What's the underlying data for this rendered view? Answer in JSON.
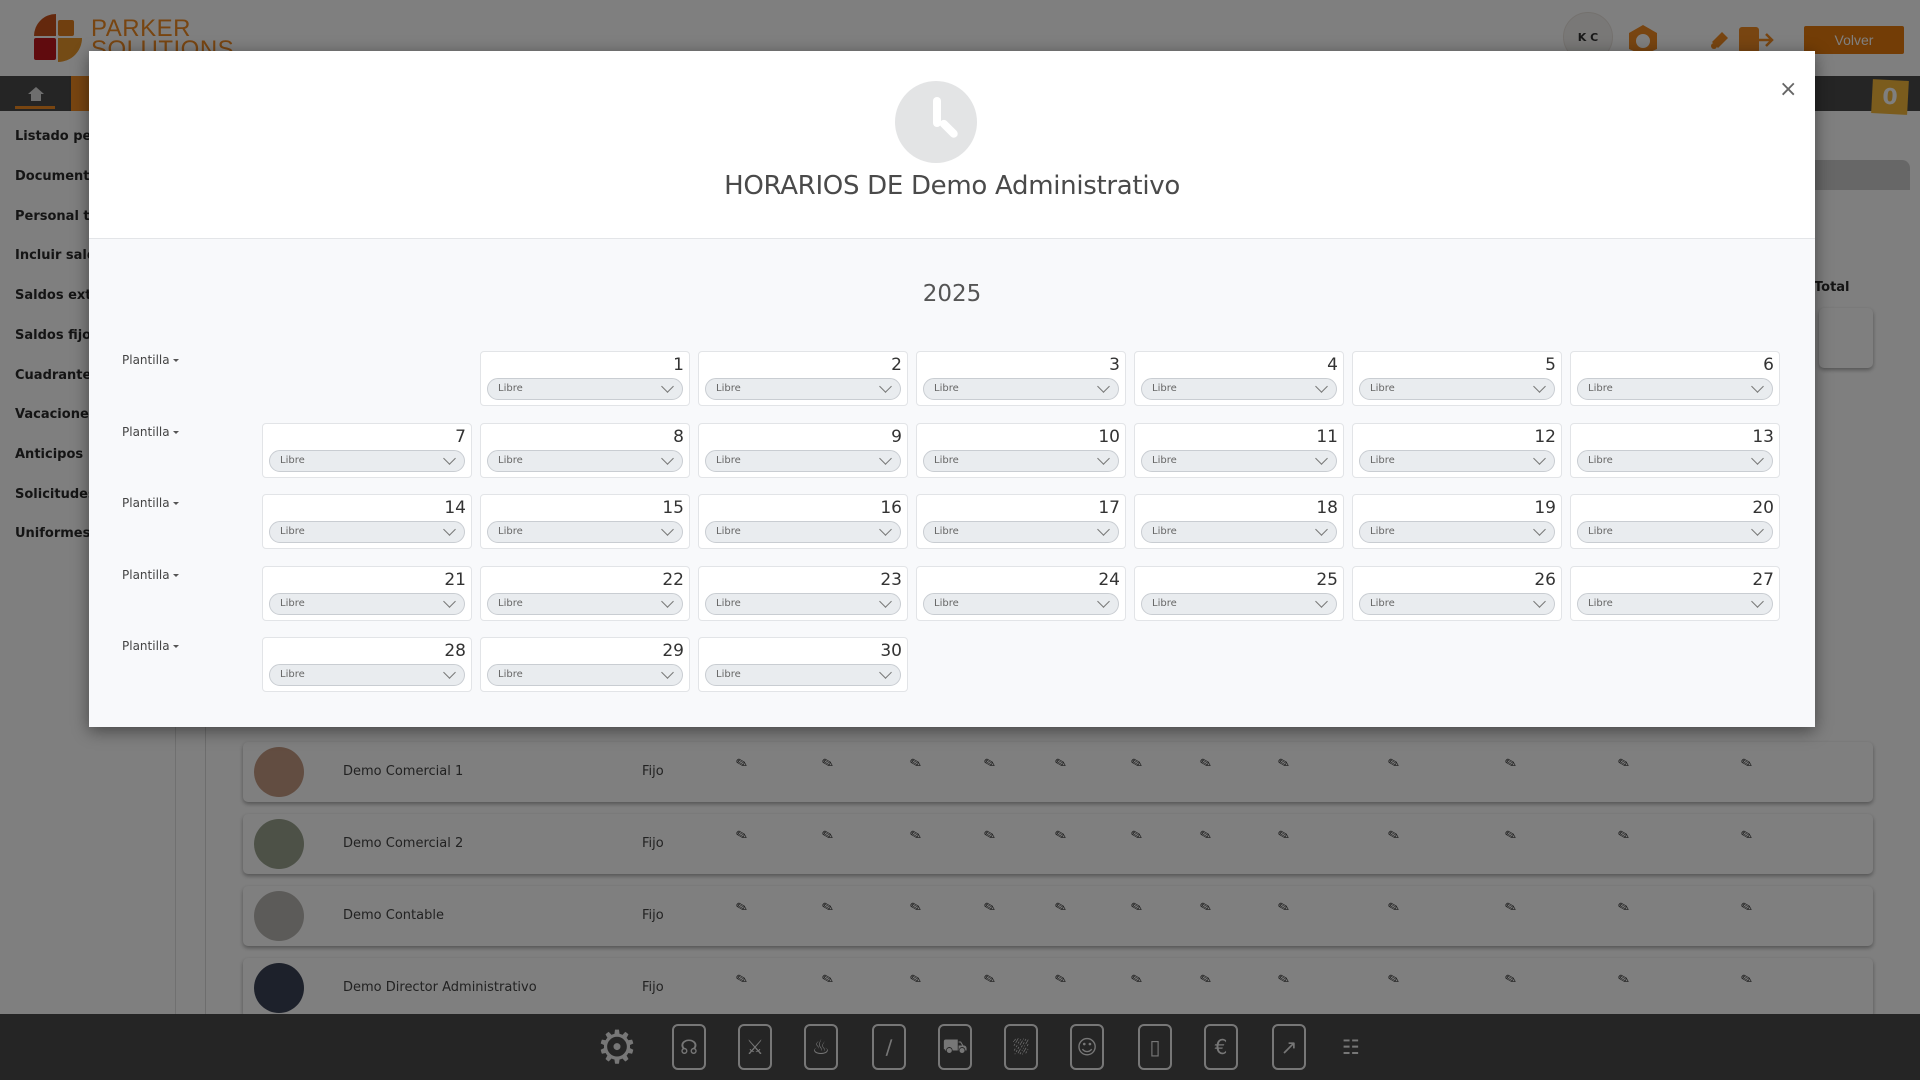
{
  "app": {
    "brand_line1": "PARKER",
    "brand_line2": "SOLUTIONS",
    "company_badge": "K C",
    "volver_label": "Volver",
    "cart_count": "0",
    "sidebar": [
      "Listado personal",
      "Documentos",
      "Personal trabajando",
      "Incluir saldos",
      "Saldos extra",
      "Saldos fijos",
      "Cuadrantes",
      "Vacaciones",
      "Anticipos",
      "Solicitudes",
      "Uniformes"
    ],
    "total_label": "Total",
    "employees": [
      {
        "name": "Demo Comercial 1",
        "type": "Fijo"
      },
      {
        "name": "Demo Comercial 2",
        "type": "Fijo"
      },
      {
        "name": "Demo Contable",
        "type": "Fijo"
      },
      {
        "name": "Demo Director Administrativo",
        "type": "Fijo"
      }
    ],
    "footer_icons": [
      "gear-icon",
      "headset-icon",
      "handshake-book-icon",
      "cutlery-book-icon",
      "whisk-icon",
      "hand-truck-icon",
      "cart-book-icon",
      "contact-book-icon",
      "phone-icon",
      "euro-book-icon",
      "chart-icon",
      "chat-user-icon"
    ]
  },
  "modal": {
    "title": "HORARIOS DE Demo Administrativo",
    "close_label": "×",
    "year": "2025",
    "week_label": "Plantilla",
    "weeks": [
      {
        "start_col": 1,
        "days": [
          {
            "day": "1",
            "value": "Libre"
          },
          {
            "day": "2",
            "value": "Libre"
          },
          {
            "day": "3",
            "value": "Libre"
          },
          {
            "day": "4",
            "value": "Libre"
          },
          {
            "day": "5",
            "value": "Libre"
          },
          {
            "day": "6",
            "value": "Libre"
          }
        ]
      },
      {
        "start_col": 0,
        "days": [
          {
            "day": "7",
            "value": "Libre"
          },
          {
            "day": "8",
            "value": "Libre"
          },
          {
            "day": "9",
            "value": "Libre"
          },
          {
            "day": "10",
            "value": "Libre"
          },
          {
            "day": "11",
            "value": "Libre"
          },
          {
            "day": "12",
            "value": "Libre"
          },
          {
            "day": "13",
            "value": "Libre"
          }
        ]
      },
      {
        "start_col": 0,
        "days": [
          {
            "day": "14",
            "value": "Libre"
          },
          {
            "day": "15",
            "value": "Libre"
          },
          {
            "day": "16",
            "value": "Libre"
          },
          {
            "day": "17",
            "value": "Libre"
          },
          {
            "day": "18",
            "value": "Libre"
          },
          {
            "day": "19",
            "value": "Libre"
          },
          {
            "day": "20",
            "value": "Libre"
          }
        ]
      },
      {
        "start_col": 0,
        "days": [
          {
            "day": "21",
            "value": "Libre"
          },
          {
            "day": "22",
            "value": "Libre"
          },
          {
            "day": "23",
            "value": "Libre"
          },
          {
            "day": "24",
            "value": "Libre"
          },
          {
            "day": "25",
            "value": "Libre"
          },
          {
            "day": "26",
            "value": "Libre"
          },
          {
            "day": "27",
            "value": "Libre"
          }
        ]
      },
      {
        "start_col": 0,
        "days": [
          {
            "day": "28",
            "value": "Libre"
          },
          {
            "day": "29",
            "value": "Libre"
          },
          {
            "day": "30",
            "value": "Libre"
          }
        ]
      }
    ]
  }
}
